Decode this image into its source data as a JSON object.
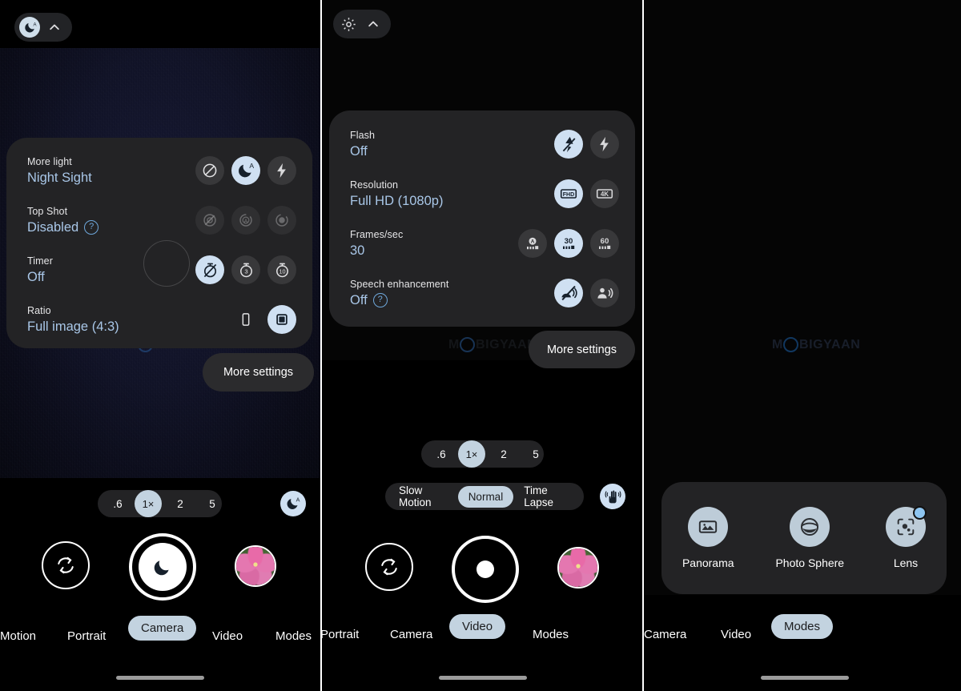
{
  "phones": [
    {
      "id": "photo-mode",
      "top_pill": {
        "icon": "night-sight-auto-icon",
        "chevron": "chevron-up-icon"
      },
      "settings_panel": {
        "rows": [
          {
            "label": "More light",
            "value": "Night Sight",
            "has_help": false,
            "options": [
              {
                "icon": "flash-off-block-icon",
                "state": "normal"
              },
              {
                "icon": "night-sight-auto-icon",
                "state": "selected"
              },
              {
                "icon": "flash-on-icon",
                "state": "normal"
              }
            ]
          },
          {
            "label": "Top Shot",
            "value": "Disabled",
            "has_help": true,
            "options": [
              {
                "icon": "top-shot-off-icon",
                "state": "dim"
              },
              {
                "icon": "top-shot-auto-icon",
                "state": "dim"
              },
              {
                "icon": "top-shot-on-icon",
                "state": "dim"
              }
            ]
          },
          {
            "label": "Timer",
            "value": "Off",
            "has_help": false,
            "options": [
              {
                "icon": "timer-off-icon",
                "state": "selected"
              },
              {
                "icon": "timer-3s-icon",
                "state": "normal"
              },
              {
                "icon": "timer-10s-icon",
                "state": "normal"
              }
            ]
          },
          {
            "label": "Ratio",
            "value": "Full image (4:3)",
            "has_help": false,
            "options": [
              {
                "icon": "ratio-9-16-icon",
                "state": "normal"
              },
              {
                "icon": "ratio-4-3-icon",
                "state": "selected"
              }
            ]
          }
        ]
      },
      "more_settings_label": "More settings",
      "watermark": "MOBIGYAAN",
      "zoom": {
        "levels": [
          ".6",
          "1×",
          "2",
          "5"
        ],
        "active_index": 1
      },
      "night_badge_icon": "night-sight-auto-icon",
      "controls": {
        "flip_icon": "camera-flip-icon",
        "shutter_icon": "night-sight-moon-icon",
        "thumbnail": "gallery-thumbnail"
      },
      "modes": [
        "Motion",
        "Portrait",
        "Camera",
        "Video",
        "Modes"
      ],
      "active_mode": "Camera",
      "modes_has_dot": false
    },
    {
      "id": "video-mode",
      "top_pill": {
        "icon": "gear-icon",
        "chevron": "chevron-up-icon"
      },
      "settings_panel": {
        "rows": [
          {
            "label": "Flash",
            "value": "Off",
            "has_help": false,
            "options": [
              {
                "icon": "flash-off-icon",
                "state": "selected"
              },
              {
                "icon": "flash-on-icon",
                "state": "normal"
              }
            ]
          },
          {
            "label": "Resolution",
            "value": "Full HD (1080p)",
            "has_help": false,
            "options": [
              {
                "icon": "fhd-icon",
                "state": "selected"
              },
              {
                "icon": "4k-icon",
                "state": "normal"
              }
            ]
          },
          {
            "label": "Frames/sec",
            "value": "30",
            "has_help": false,
            "options": [
              {
                "icon": "fps-auto-icon",
                "state": "normal"
              },
              {
                "icon": "fps-30-icon",
                "state": "selected"
              },
              {
                "icon": "fps-60-icon",
                "state": "normal"
              }
            ]
          },
          {
            "label": "Speech enhancement",
            "value": "Off",
            "has_help": true,
            "options": [
              {
                "icon": "speech-off-icon",
                "state": "selected"
              },
              {
                "icon": "speech-on-icon",
                "state": "normal"
              }
            ]
          }
        ]
      },
      "more_settings_label": "More settings",
      "watermark": "MOBIGYAAN",
      "zoom": {
        "levels": [
          ".6",
          "1×",
          "2",
          "5"
        ],
        "active_index": 1
      },
      "video_modes": {
        "options": [
          "Slow Motion",
          "Normal",
          "Time Lapse"
        ],
        "active_index": 1
      },
      "stabilization_icon": "hand-stabilization-icon",
      "controls": {
        "flip_icon": "camera-flip-icon",
        "shutter_icon": "record-dot-icon",
        "thumbnail": "gallery-thumbnail"
      },
      "modes": [
        "Portrait",
        "Camera",
        "Video",
        "Modes"
      ],
      "active_mode": "Video",
      "modes_has_dot": true
    },
    {
      "id": "modes-screen",
      "watermark": "MOBIGYAAN",
      "modes_panel": {
        "items": [
          {
            "label": "Panorama",
            "icon": "panorama-icon",
            "has_dot": false
          },
          {
            "label": "Photo Sphere",
            "icon": "photo-sphere-icon",
            "has_dot": false
          },
          {
            "label": "Lens",
            "icon": "google-lens-icon",
            "has_dot": true
          }
        ]
      },
      "modes": [
        "Camera",
        "Video",
        "Modes"
      ],
      "active_mode": "Modes",
      "modes_has_dot": true
    }
  ],
  "colors": {
    "accent_light": "#cfe0f2",
    "chip_active": "#c3d3e0",
    "panel_bg": "#232325",
    "value_text": "#a9c7e8",
    "blue_dot": "#8ec5f0"
  }
}
